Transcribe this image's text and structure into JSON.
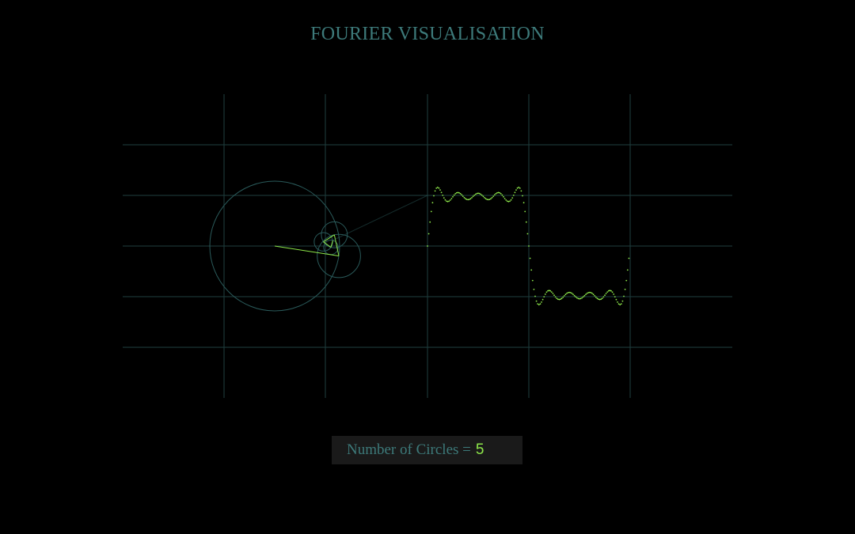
{
  "page": {
    "title": "FOURIER VISUALISATION"
  },
  "control": {
    "label": "Number of Circles =",
    "value": "5",
    "circles": 5
  },
  "colors": {
    "background": "#000000",
    "grid": "#1f3f3f",
    "circle": "#2a5a5a",
    "accent": "#8ee84a",
    "text": "#3d7a7a"
  },
  "visualisation": {
    "wave_type": "square",
    "phase_fraction": 0.05
  }
}
